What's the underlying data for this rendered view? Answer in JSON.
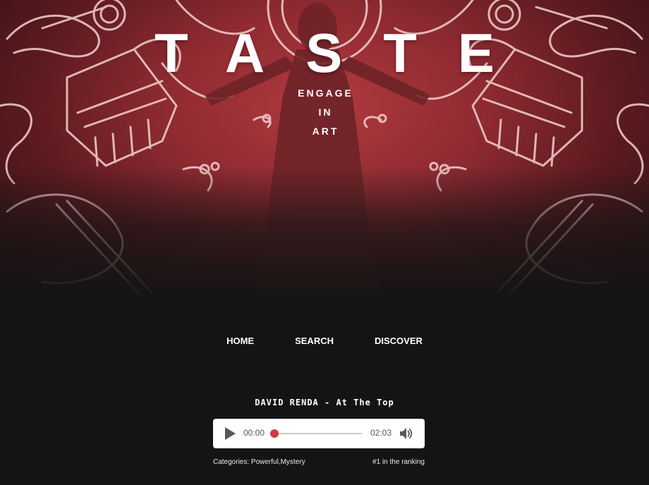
{
  "hero": {
    "title": "TASTE",
    "tagline": [
      "ENGAGE",
      "IN",
      "ART"
    ]
  },
  "nav": {
    "items": [
      {
        "label": "HOME"
      },
      {
        "label": "SEARCH"
      },
      {
        "label": "DISCOVER"
      }
    ]
  },
  "track": {
    "title": "DAVID RENDA - At The Top",
    "player": {
      "current_time": "00:00",
      "total_time": "02:03",
      "progress": 0.02,
      "play_icon": "play-icon",
      "volume_icon": "volume-icon"
    },
    "categories": "Categories: Powerful,Mystery",
    "ranking": "#1 in the ranking"
  },
  "colors": {
    "background": "#141414",
    "hero_red": "#b23a40",
    "neon": "#f2c9c9",
    "accent": "#d03a41",
    "player_bg": "#ffffff",
    "player_icon": "#54585f"
  }
}
